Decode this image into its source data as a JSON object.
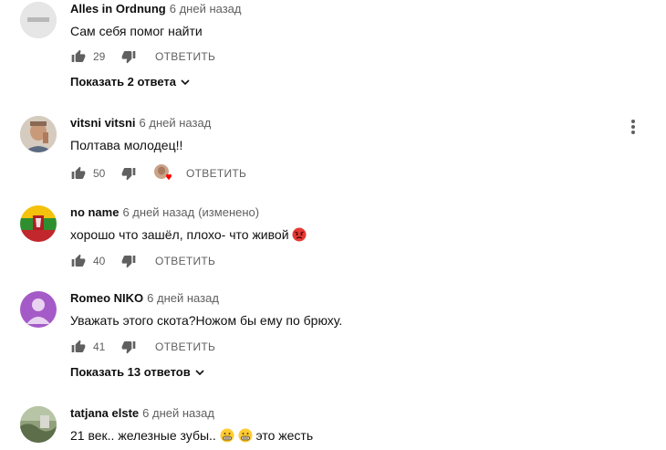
{
  "comments": [
    {
      "author": "Alles in Ordnung",
      "time": "6 дней назад",
      "text": "Сам себя помог найти",
      "likes": "29",
      "reply_label": "ОТВЕТИТЬ",
      "replies_label": "Показать 2 ответа"
    },
    {
      "author": "vitsni vitsni",
      "time": "6 дней назад",
      "text": "Полтава молодец!!",
      "likes": "50",
      "reply_label": "ОТВЕТИТЬ",
      "creator_heart": true
    },
    {
      "author": "no name",
      "time": "6 дней назад",
      "edited": "(изменено)",
      "text": "хорошо что зашёл, плохо- что живой",
      "likes": "40",
      "reply_label": "ОТВЕТИТЬ"
    },
    {
      "author": "Romeo NIKO",
      "time": "6 дней назад",
      "text": "Уважать этого скота?Ножом бы ему по брюху.",
      "likes": "41",
      "reply_label": "ОТВЕТИТЬ",
      "replies_label": "Показать 13 ответов"
    },
    {
      "author": "tatjana elste",
      "time": "6 дней назад",
      "text_part1": "21 век.. железные зубы..",
      "text_part2": "это жесть"
    }
  ],
  "colors": {
    "secondary_text": "#606060",
    "primary_text": "#0f0f0f",
    "avatar_purple": "#9b59c4",
    "heart_red": "#ff0000"
  }
}
